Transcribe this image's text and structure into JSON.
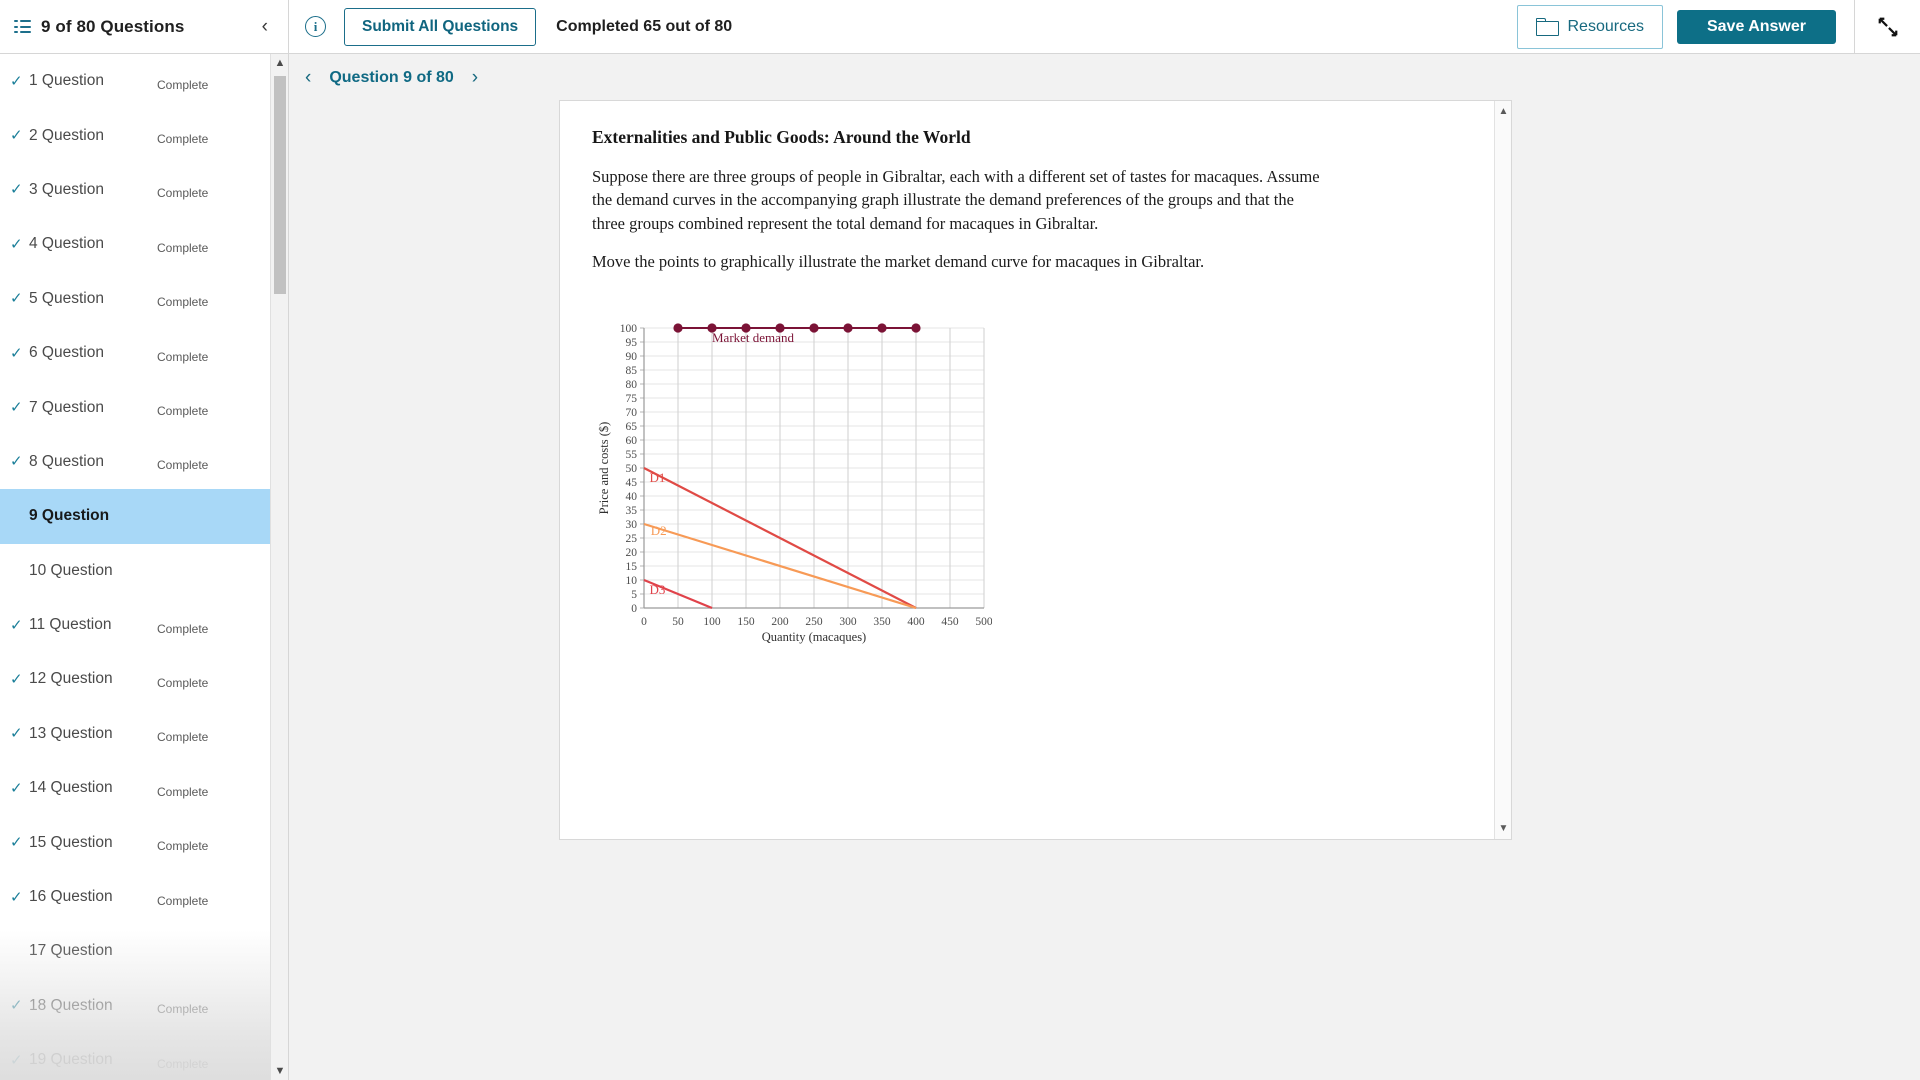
{
  "header": {
    "question_counter": "9 of 80 Questions",
    "menu_icon": "hamburger-icon",
    "collapse_icon": "chevron-left-icon",
    "info_icon": "info-circle-icon",
    "submit_label": "Submit All Questions",
    "completed_text": "Completed 65 out of 80",
    "resources_label": "Resources",
    "resources_icon": "folder-icon",
    "save_label": "Save Answer",
    "expand_icon": "collapse-arrows-icon"
  },
  "sidebar": {
    "items": [
      {
        "label": "1 Question",
        "status": "Complete",
        "complete": true,
        "active": false
      },
      {
        "label": "2 Question",
        "status": "Complete",
        "complete": true,
        "active": false
      },
      {
        "label": "3 Question",
        "status": "Complete",
        "complete": true,
        "active": false
      },
      {
        "label": "4 Question",
        "status": "Complete",
        "complete": true,
        "active": false
      },
      {
        "label": "5 Question",
        "status": "Complete",
        "complete": true,
        "active": false
      },
      {
        "label": "6 Question",
        "status": "Complete",
        "complete": true,
        "active": false
      },
      {
        "label": "7 Question",
        "status": "Complete",
        "complete": true,
        "active": false
      },
      {
        "label": "8 Question",
        "status": "Complete",
        "complete": true,
        "active": false
      },
      {
        "label": "9 Question",
        "status": "",
        "complete": false,
        "active": true
      },
      {
        "label": "10 Question",
        "status": "",
        "complete": false,
        "active": false
      },
      {
        "label": "11 Question",
        "status": "Complete",
        "complete": true,
        "active": false
      },
      {
        "label": "12 Question",
        "status": "Complete",
        "complete": true,
        "active": false
      },
      {
        "label": "13 Question",
        "status": "Complete",
        "complete": true,
        "active": false
      },
      {
        "label": "14 Question",
        "status": "Complete",
        "complete": true,
        "active": false
      },
      {
        "label": "15 Question",
        "status": "Complete",
        "complete": true,
        "active": false
      },
      {
        "label": "16 Question",
        "status": "Complete",
        "complete": true,
        "active": false
      },
      {
        "label": "17 Question",
        "status": "",
        "complete": false,
        "active": false
      },
      {
        "label": "18 Question",
        "status": "Complete",
        "complete": true,
        "active": false
      },
      {
        "label": "19 Question",
        "status": "Complete",
        "complete": true,
        "active": false
      }
    ],
    "check_glyph": "✓"
  },
  "question_nav": {
    "prev_icon": "chevron-left-icon",
    "next_icon": "chevron-right-icon",
    "title": "Question 9 of 80"
  },
  "question": {
    "title": "Externalities and Public Goods: Around the World",
    "paragraph_1": "Suppose there are three groups of people in Gibraltar, each with a different set of tastes for macaques. Assume the demand curves in the accompanying graph illustrate the demand preferences of the groups and that the three groups combined represent the total demand for macaques in Gibraltar.",
    "paragraph_2": "Move the points to graphically illustrate the market demand curve for macaques in Gibraltar."
  },
  "colors": {
    "accent_teal": "#0d6f87",
    "active_row": "#a8d8f7",
    "market_demand": "#7b1336",
    "d1": "#e04a45",
    "d2": "#f79a56",
    "d3": "#e0424a"
  },
  "chart_data": {
    "type": "line",
    "title": "",
    "xlabel": "Quantity (macaques)",
    "ylabel": "Price and costs ($)",
    "xlim": [
      0,
      500
    ],
    "ylim": [
      0,
      100
    ],
    "xticks": [
      0,
      50,
      100,
      150,
      200,
      250,
      300,
      350,
      400,
      450,
      500
    ],
    "yticks": [
      0,
      5,
      10,
      15,
      20,
      25,
      30,
      35,
      40,
      45,
      50,
      55,
      60,
      65,
      70,
      75,
      80,
      85,
      90,
      95,
      100
    ],
    "grid": true,
    "legend": "inline-labels",
    "series": [
      {
        "name": "Market demand",
        "color": "#7b1336",
        "draggable": true,
        "label_x": 100,
        "label_y": 95,
        "points": [
          {
            "x": 50,
            "y": 100
          },
          {
            "x": 100,
            "y": 100
          },
          {
            "x": 150,
            "y": 100
          },
          {
            "x": 200,
            "y": 100
          },
          {
            "x": 250,
            "y": 100
          },
          {
            "x": 300,
            "y": 100
          },
          {
            "x": 350,
            "y": 100
          },
          {
            "x": 400,
            "y": 100
          }
        ]
      },
      {
        "name": "D1",
        "color": "#e04a45",
        "draggable": false,
        "label_x": 8,
        "label_y": 45,
        "points": [
          {
            "x": 0,
            "y": 50
          },
          {
            "x": 400,
            "y": 0
          }
        ]
      },
      {
        "name": "D2",
        "color": "#f79a56",
        "draggable": false,
        "label_x": 10,
        "label_y": 26,
        "points": [
          {
            "x": 0,
            "y": 30
          },
          {
            "x": 400,
            "y": 0
          }
        ]
      },
      {
        "name": "D3",
        "color": "#e0424a",
        "draggable": false,
        "label_x": 8,
        "label_y": 5,
        "points": [
          {
            "x": 0,
            "y": 10
          },
          {
            "x": 100,
            "y": 0
          }
        ]
      }
    ]
  }
}
